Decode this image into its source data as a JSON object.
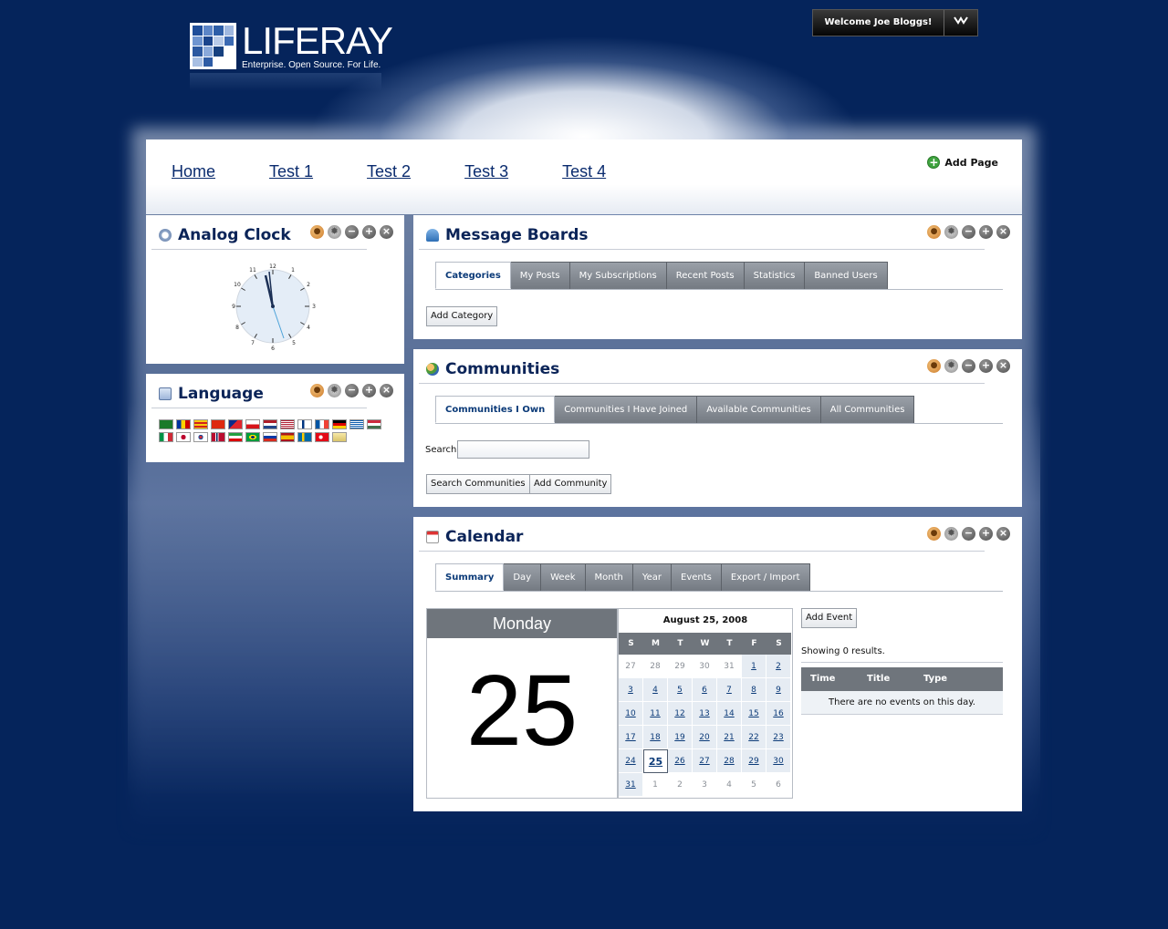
{
  "header": {
    "logo_word": "LIFERAY",
    "logo_tagline": "Enterprise. Open Source. For Life.",
    "welcome": "Welcome Joe Bloggs!"
  },
  "nav": {
    "tabs": [
      "Home",
      "Test 1",
      "Test 2",
      "Test 3",
      "Test 4"
    ],
    "add_page": "Add Page"
  },
  "portlets": {
    "clock": {
      "title": "Analog Clock"
    },
    "language": {
      "title": "Language"
    },
    "message_boards": {
      "title": "Message Boards",
      "tabs": [
        "Categories",
        "My Posts",
        "My Subscriptions",
        "Recent Posts",
        "Statistics",
        "Banned Users"
      ],
      "active_tab": "Categories",
      "add_category": "Add Category"
    },
    "communities": {
      "title": "Communities",
      "tabs": [
        "Communities I Own",
        "Communities I Have Joined",
        "Available Communities",
        "All Communities"
      ],
      "active_tab": "Communities I Own",
      "search_label": "Search",
      "search_value": "",
      "search_button": "Search Communities",
      "add_button": "Add Community"
    },
    "calendar": {
      "title": "Calendar",
      "tabs": [
        "Summary",
        "Day",
        "Week",
        "Month",
        "Year",
        "Events",
        "Export / Import"
      ],
      "active_tab": "Summary",
      "day_name": "Monday",
      "day_number": "25",
      "month_title": "August 25, 2008",
      "weekdays": [
        "S",
        "M",
        "T",
        "W",
        "T",
        "F",
        "S"
      ],
      "add_event": "Add Event",
      "showing": "Showing 0 results.",
      "table_headers": [
        "Time",
        "Title",
        "Type"
      ],
      "no_events": "There are no events on this day."
    }
  }
}
